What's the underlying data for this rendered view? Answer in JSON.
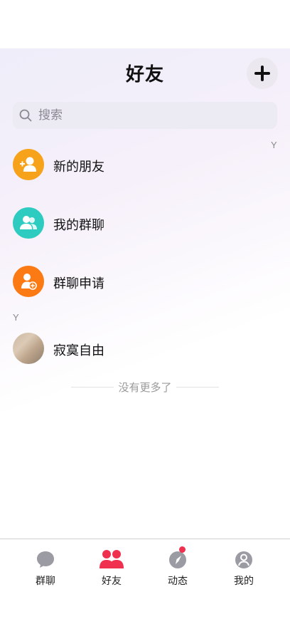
{
  "header": {
    "title": "好友",
    "add_icon": "plus-icon"
  },
  "search": {
    "placeholder": "搜索",
    "icon": "search-icon"
  },
  "index_letters": {
    "top_right": "Y",
    "section": "Y"
  },
  "special_rows": [
    {
      "label": "新的朋友",
      "icon": "add-friend-icon",
      "color": "#F7A21B"
    },
    {
      "label": "我的群聊",
      "icon": "group-icon",
      "color": "#2DCBC0"
    },
    {
      "label": "群聊申请",
      "icon": "group-request-icon",
      "color": "#FB7A14"
    }
  ],
  "contacts": [
    {
      "name": "寂寞自由",
      "avatar": "photo-avatar"
    }
  ],
  "footer_text": "没有更多了",
  "tabbar": {
    "tabs": [
      {
        "label": "群聊",
        "icon": "chat-bubble-icon",
        "active": false
      },
      {
        "label": "好友",
        "icon": "friends-icon",
        "active": true
      },
      {
        "label": "动态",
        "icon": "compass-icon",
        "active": false,
        "badge_dot": true
      },
      {
        "label": "我的",
        "icon": "profile-icon",
        "active": false
      }
    ],
    "active_color": "#F0304F",
    "inactive_color": "#9B9BA3"
  }
}
